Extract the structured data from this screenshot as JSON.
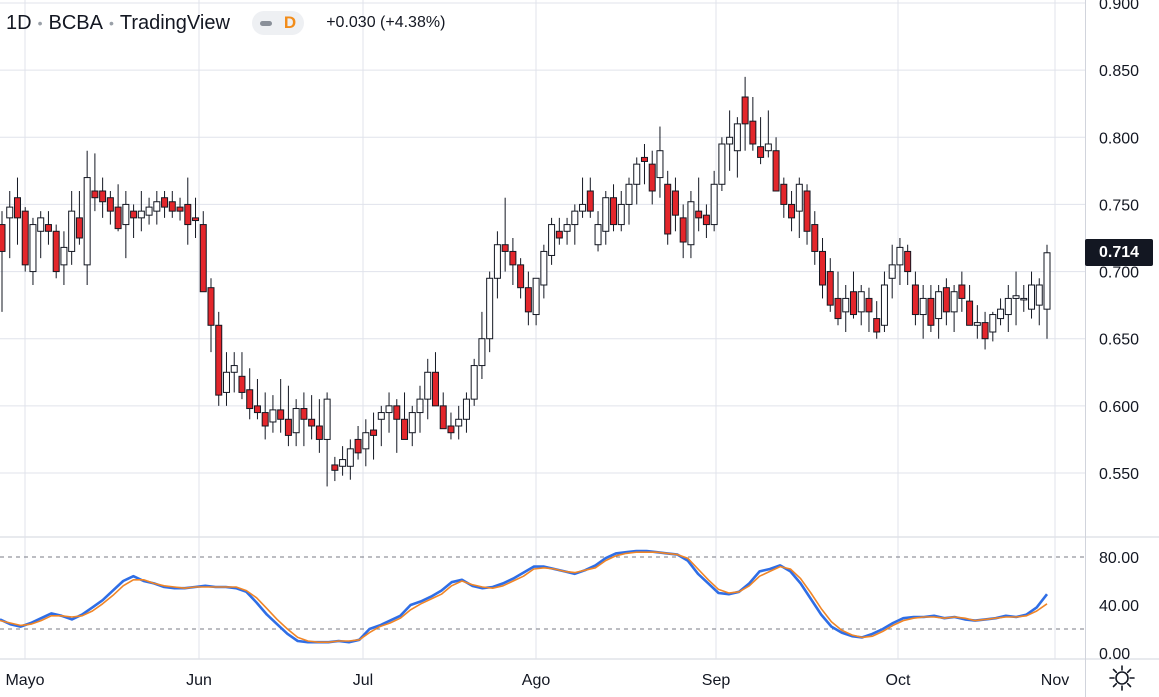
{
  "header": {
    "interval": "1D",
    "exchange": "BCBA",
    "source": "TradingView",
    "badge": "D",
    "change": "+0.030 (+4.38%)"
  },
  "colors": {
    "up_body": "#ffffff",
    "up_border": "#131722",
    "down_body": "#e3262b",
    "down_border": "#131722",
    "stoch_k": "#2f6ee6",
    "stoch_d": "#f08526",
    "grid": "#e0e3eb",
    "text": "#131722"
  },
  "chart_data": [
    {
      "type": "candlestick",
      "title": "",
      "ylim": [
        0.5,
        0.9
      ],
      "y_ticks": [
        "0.550",
        "0.600",
        "0.650",
        "0.700",
        "0.750",
        "0.800",
        "0.850",
        "0.900"
      ],
      "x_labels": [
        "Mayo",
        "Jun",
        "Jul",
        "Ago",
        "Sep",
        "Oct",
        "Nov"
      ],
      "last_price": "0.714",
      "candles_ohlc": [
        [
          0.735,
          0.745,
          0.67,
          0.715
        ],
        [
          0.74,
          0.76,
          0.71,
          0.748
        ],
        [
          0.755,
          0.77,
          0.72,
          0.74
        ],
        [
          0.745,
          0.748,
          0.7,
          0.705
        ],
        [
          0.7,
          0.74,
          0.69,
          0.735
        ],
        [
          0.73,
          0.745,
          0.71,
          0.74
        ],
        [
          0.735,
          0.745,
          0.72,
          0.73
        ],
        [
          0.73,
          0.735,
          0.695,
          0.7
        ],
        [
          0.705,
          0.73,
          0.69,
          0.718
        ],
        [
          0.715,
          0.76,
          0.705,
          0.745
        ],
        [
          0.74,
          0.76,
          0.72,
          0.725
        ],
        [
          0.705,
          0.79,
          0.69,
          0.77
        ],
        [
          0.76,
          0.788,
          0.745,
          0.755
        ],
        [
          0.76,
          0.77,
          0.74,
          0.752
        ],
        [
          0.755,
          0.76,
          0.735,
          0.745
        ],
        [
          0.748,
          0.765,
          0.73,
          0.732
        ],
        [
          0.735,
          0.76,
          0.71,
          0.75
        ],
        [
          0.745,
          0.75,
          0.725,
          0.74
        ],
        [
          0.74,
          0.76,
          0.73,
          0.745
        ],
        [
          0.742,
          0.755,
          0.735,
          0.748
        ],
        [
          0.745,
          0.76,
          0.735,
          0.752
        ],
        [
          0.755,
          0.76,
          0.74,
          0.748
        ],
        [
          0.752,
          0.76,
          0.74,
          0.745
        ],
        [
          0.748,
          0.755,
          0.738,
          0.745
        ],
        [
          0.75,
          0.77,
          0.72,
          0.735
        ],
        [
          0.74,
          0.755,
          0.725,
          0.738
        ],
        [
          0.735,
          0.745,
          0.7,
          0.685
        ],
        [
          0.688,
          0.695,
          0.64,
          0.66
        ],
        [
          0.66,
          0.67,
          0.6,
          0.608
        ],
        [
          0.61,
          0.64,
          0.6,
          0.625
        ],
        [
          0.625,
          0.64,
          0.61,
          0.63
        ],
        [
          0.622,
          0.64,
          0.605,
          0.61
        ],
        [
          0.612,
          0.628,
          0.59,
          0.598
        ],
        [
          0.6,
          0.62,
          0.59,
          0.595
        ],
        [
          0.595,
          0.61,
          0.575,
          0.585
        ],
        [
          0.588,
          0.608,
          0.58,
          0.597
        ],
        [
          0.597,
          0.62,
          0.58,
          0.59
        ],
        [
          0.59,
          0.615,
          0.57,
          0.578
        ],
        [
          0.58,
          0.605,
          0.57,
          0.598
        ],
        [
          0.598,
          0.61,
          0.57,
          0.59
        ],
        [
          0.59,
          0.608,
          0.575,
          0.585
        ],
        [
          0.585,
          0.605,
          0.565,
          0.575
        ],
        [
          0.575,
          0.61,
          0.54,
          0.605
        ],
        [
          0.556,
          0.562,
          0.544,
          0.552
        ],
        [
          0.555,
          0.57,
          0.548,
          0.56
        ],
        [
          0.555,
          0.575,
          0.545,
          0.568
        ],
        [
          0.575,
          0.585,
          0.56,
          0.565
        ],
        [
          0.568,
          0.59,
          0.555,
          0.58
        ],
        [
          0.582,
          0.595,
          0.56,
          0.578
        ],
        [
          0.59,
          0.6,
          0.57,
          0.595
        ],
        [
          0.595,
          0.61,
          0.58,
          0.6
        ],
        [
          0.6,
          0.605,
          0.565,
          0.59
        ],
        [
          0.59,
          0.61,
          0.58,
          0.575
        ],
        [
          0.58,
          0.6,
          0.57,
          0.595
        ],
        [
          0.595,
          0.615,
          0.58,
          0.605
        ],
        [
          0.605,
          0.635,
          0.59,
          0.625
        ],
        [
          0.625,
          0.64,
          0.6,
          0.6
        ],
        [
          0.6,
          0.61,
          0.59,
          0.583
        ],
        [
          0.585,
          0.595,
          0.575,
          0.58
        ],
        [
          0.585,
          0.6,
          0.575,
          0.59
        ],
        [
          0.59,
          0.61,
          0.58,
          0.605
        ],
        [
          0.605,
          0.635,
          0.6,
          0.63
        ],
        [
          0.63,
          0.67,
          0.62,
          0.65
        ],
        [
          0.65,
          0.7,
          0.64,
          0.695
        ],
        [
          0.695,
          0.73,
          0.68,
          0.72
        ],
        [
          0.72,
          0.755,
          0.7,
          0.715
        ],
        [
          0.715,
          0.725,
          0.69,
          0.705
        ],
        [
          0.705,
          0.71,
          0.68,
          0.688
        ],
        [
          0.688,
          0.7,
          0.66,
          0.67
        ],
        [
          0.668,
          0.69,
          0.66,
          0.695
        ],
        [
          0.69,
          0.72,
          0.68,
          0.715
        ],
        [
          0.712,
          0.74,
          0.705,
          0.735
        ],
        [
          0.73,
          0.74,
          0.72,
          0.725
        ],
        [
          0.73,
          0.74,
          0.72,
          0.735
        ],
        [
          0.735,
          0.75,
          0.72,
          0.745
        ],
        [
          0.745,
          0.77,
          0.74,
          0.75
        ],
        [
          0.76,
          0.77,
          0.74,
          0.745
        ],
        [
          0.72,
          0.745,
          0.715,
          0.735
        ],
        [
          0.73,
          0.76,
          0.72,
          0.755
        ],
        [
          0.755,
          0.765,
          0.73,
          0.735
        ],
        [
          0.735,
          0.76,
          0.73,
          0.75
        ],
        [
          0.75,
          0.77,
          0.735,
          0.765
        ],
        [
          0.765,
          0.785,
          0.75,
          0.78
        ],
        [
          0.785,
          0.795,
          0.765,
          0.782
        ],
        [
          0.78,
          0.79,
          0.75,
          0.76
        ],
        [
          0.77,
          0.808,
          0.755,
          0.79
        ],
        [
          0.765,
          0.775,
          0.72,
          0.728
        ],
        [
          0.76,
          0.77,
          0.73,
          0.742
        ],
        [
          0.74,
          0.75,
          0.71,
          0.722
        ],
        [
          0.72,
          0.76,
          0.71,
          0.752
        ],
        [
          0.745,
          0.77,
          0.73,
          0.74
        ],
        [
          0.742,
          0.75,
          0.725,
          0.735
        ],
        [
          0.735,
          0.775,
          0.73,
          0.765
        ],
        [
          0.765,
          0.8,
          0.76,
          0.795
        ],
        [
          0.795,
          0.82,
          0.775,
          0.8
        ],
        [
          0.79,
          0.815,
          0.77,
          0.81
        ],
        [
          0.83,
          0.845,
          0.79,
          0.81
        ],
        [
          0.812,
          0.83,
          0.79,
          0.795
        ],
        [
          0.793,
          0.815,
          0.78,
          0.785
        ],
        [
          0.79,
          0.82,
          0.785,
          0.795
        ],
        [
          0.79,
          0.8,
          0.76,
          0.76
        ],
        [
          0.765,
          0.77,
          0.74,
          0.75
        ],
        [
          0.75,
          0.76,
          0.73,
          0.74
        ],
        [
          0.745,
          0.77,
          0.725,
          0.765
        ],
        [
          0.76,
          0.765,
          0.72,
          0.73
        ],
        [
          0.735,
          0.745,
          0.705,
          0.715
        ],
        [
          0.715,
          0.725,
          0.68,
          0.69
        ],
        [
          0.7,
          0.71,
          0.67,
          0.675
        ],
        [
          0.68,
          0.7,
          0.66,
          0.665
        ],
        [
          0.67,
          0.69,
          0.655,
          0.68
        ],
        [
          0.685,
          0.7,
          0.665,
          0.668
        ],
        [
          0.67,
          0.69,
          0.66,
          0.685
        ],
        [
          0.68,
          0.688,
          0.655,
          0.67
        ],
        [
          0.665,
          0.678,
          0.65,
          0.655
        ],
        [
          0.66,
          0.7,
          0.655,
          0.69
        ],
        [
          0.695,
          0.72,
          0.68,
          0.705
        ],
        [
          0.705,
          0.725,
          0.69,
          0.718
        ],
        [
          0.715,
          0.72,
          0.69,
          0.7
        ],
        [
          0.69,
          0.7,
          0.66,
          0.668
        ],
        [
          0.668,
          0.69,
          0.65,
          0.68
        ],
        [
          0.68,
          0.69,
          0.655,
          0.66
        ],
        [
          0.665,
          0.69,
          0.65,
          0.685
        ],
        [
          0.688,
          0.695,
          0.66,
          0.67
        ],
        [
          0.67,
          0.69,
          0.655,
          0.685
        ],
        [
          0.69,
          0.7,
          0.67,
          0.68
        ],
        [
          0.678,
          0.69,
          0.66,
          0.66
        ],
        [
          0.66,
          0.675,
          0.65,
          0.662
        ],
        [
          0.662,
          0.67,
          0.642,
          0.65
        ],
        [
          0.655,
          0.67,
          0.648,
          0.668
        ],
        [
          0.665,
          0.68,
          0.66,
          0.672
        ],
        [
          0.668,
          0.69,
          0.655,
          0.68
        ],
        [
          0.68,
          0.7,
          0.66,
          0.682
        ],
        [
          0.68,
          0.69,
          0.67,
          0.68
        ],
        [
          0.672,
          0.7,
          0.665,
          0.69
        ],
        [
          0.675,
          0.695,
          0.66,
          0.69
        ],
        [
          0.672,
          0.72,
          0.65,
          0.714
        ]
      ]
    },
    {
      "type": "line",
      "title": "",
      "ylim": [
        0,
        90
      ],
      "y_ticks": [
        "0.00",
        "40.00",
        "80.00"
      ],
      "reference_lines": [
        20,
        80
      ],
      "series": [
        {
          "values": [
            28,
            24,
            22,
            25,
            29,
            33,
            31,
            28,
            32,
            38,
            44,
            52,
            60,
            64,
            60,
            58,
            55,
            54,
            54,
            55,
            56,
            55,
            55,
            54,
            51,
            42,
            32,
            24,
            16,
            10,
            9,
            9,
            9,
            10,
            9,
            11,
            20,
            23,
            27,
            31,
            40,
            43,
            47,
            52,
            59,
            61,
            56,
            54,
            55,
            58,
            62,
            67,
            72,
            72,
            70,
            68,
            66,
            69,
            73,
            79,
            83,
            84,
            85,
            85,
            84,
            83,
            82,
            77,
            66,
            58,
            50,
            49,
            51,
            58,
            68,
            70,
            73,
            68,
            58,
            45,
            32,
            22,
            17,
            14,
            13,
            16,
            20,
            25,
            29,
            30,
            30,
            31,
            29,
            30,
            28,
            27,
            28,
            29,
            31,
            30,
            32,
            38,
            49
          ]
        },
        {
          "values": [
            27,
            25,
            23,
            24,
            27,
            31,
            31,
            30,
            31,
            35,
            41,
            48,
            56,
            61,
            61,
            58,
            56,
            55,
            54,
            55,
            55,
            55,
            55,
            55,
            52,
            46,
            37,
            28,
            20,
            13,
            10,
            9,
            9,
            10,
            10,
            11,
            17,
            22,
            25,
            29,
            36,
            41,
            45,
            49,
            56,
            60,
            57,
            55,
            54,
            56,
            60,
            64,
            70,
            71,
            70,
            68,
            67,
            69,
            71,
            77,
            81,
            83,
            84,
            84,
            84,
            83,
            82,
            79,
            70,
            61,
            53,
            50,
            51,
            56,
            64,
            68,
            72,
            70,
            62,
            50,
            37,
            26,
            19,
            15,
            13,
            14,
            18,
            23,
            27,
            29,
            30,
            30,
            29,
            30,
            29,
            27,
            28,
            29,
            30,
            30,
            31,
            35,
            41
          ]
        }
      ]
    }
  ]
}
